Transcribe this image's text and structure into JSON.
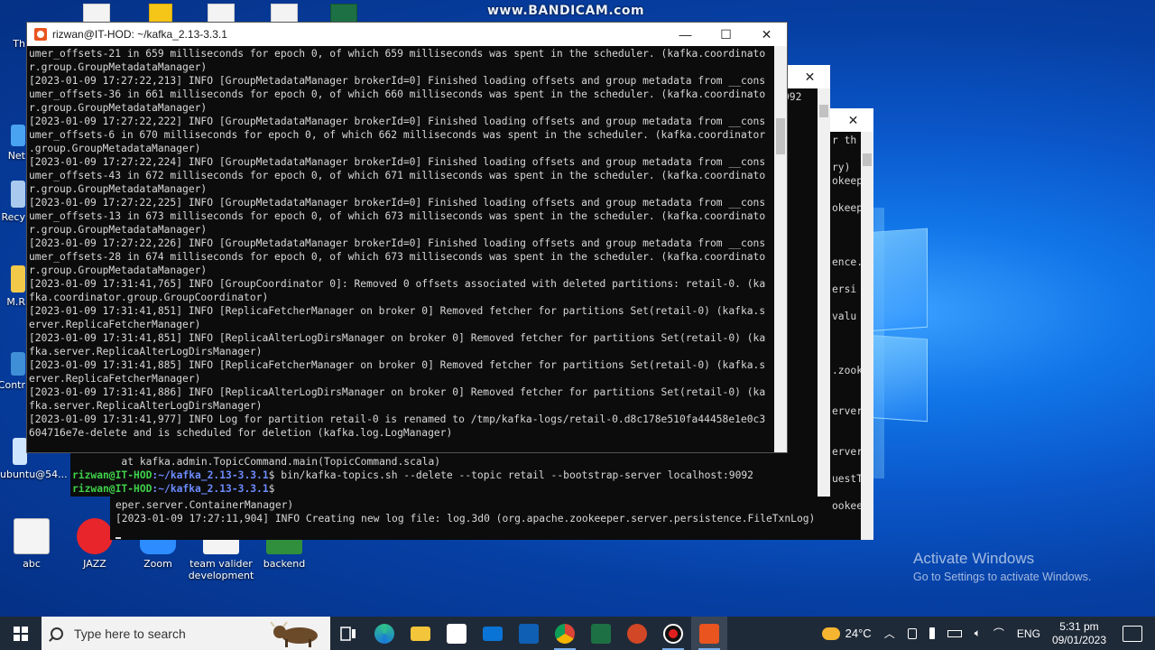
{
  "watermark": "www.BANDICAM.com",
  "desktop_icons": [
    {
      "id": "abc",
      "label": "abc"
    },
    {
      "id": "jazz",
      "label": "JAZZ"
    },
    {
      "id": "zoom",
      "label": "Zoom"
    },
    {
      "id": "team",
      "label": "team valider development"
    },
    {
      "id": "backend",
      "label": "backend"
    }
  ],
  "desktop_partial_labels": [
    "Th",
    "Net",
    "Recy",
    "M.R",
    "Contr",
    "ubuntu@54..."
  ],
  "main_window": {
    "title": "rizwan@IT-HOD: ~/kafka_2.13-3.3.1",
    "minimize": "—",
    "maximize": "☐",
    "close": "✕",
    "lines": [
      "umer_offsets-21 in 659 milliseconds for epoch 0, of which 659 milliseconds was spent in the scheduler. (kafka.coordinato",
      "r.group.GroupMetadataManager)",
      "[2023-01-09 17:27:22,213] INFO [GroupMetadataManager brokerId=0] Finished loading offsets and group metadata from __cons",
      "umer_offsets-36 in 661 milliseconds for epoch 0, of which 660 milliseconds was spent in the scheduler. (kafka.coordinato",
      "r.group.GroupMetadataManager)",
      "[2023-01-09 17:27:22,222] INFO [GroupMetadataManager brokerId=0] Finished loading offsets and group metadata from __cons",
      "umer_offsets-6 in 670 milliseconds for epoch 0, of which 662 milliseconds was spent in the scheduler. (kafka.coordinator",
      ".group.GroupMetadataManager)",
      "[2023-01-09 17:27:22,224] INFO [GroupMetadataManager brokerId=0] Finished loading offsets and group metadata from __cons",
      "umer_offsets-43 in 672 milliseconds for epoch 0, of which 671 milliseconds was spent in the scheduler. (kafka.coordinato",
      "r.group.GroupMetadataManager)",
      "[2023-01-09 17:27:22,225] INFO [GroupMetadataManager brokerId=0] Finished loading offsets and group metadata from __cons",
      "umer_offsets-13 in 673 milliseconds for epoch 0, of which 673 milliseconds was spent in the scheduler. (kafka.coordinato",
      "r.group.GroupMetadataManager)",
      "[2023-01-09 17:27:22,226] INFO [GroupMetadataManager brokerId=0] Finished loading offsets and group metadata from __cons",
      "umer_offsets-28 in 674 milliseconds for epoch 0, of which 673 milliseconds was spent in the scheduler. (kafka.coordinato",
      "r.group.GroupMetadataManager)",
      "[2023-01-09 17:31:41,765] INFO [GroupCoordinator 0]: Removed 0 offsets associated with deleted partitions: retail-0. (ka",
      "fka.coordinator.group.GroupCoordinator)",
      "[2023-01-09 17:31:41,851] INFO [ReplicaFetcherManager on broker 0] Removed fetcher for partitions Set(retail-0) (kafka.s",
      "erver.ReplicaFetcherManager)",
      "[2023-01-09 17:31:41,851] INFO [ReplicaAlterLogDirsManager on broker 0] Removed fetcher for partitions Set(retail-0) (ka",
      "fka.server.ReplicaAlterLogDirsManager)",
      "[2023-01-09 17:31:41,885] INFO [ReplicaFetcherManager on broker 0] Removed fetcher for partitions Set(retail-0) (kafka.s",
      "erver.ReplicaFetcherManager)",
      "[2023-01-09 17:31:41,886] INFO [ReplicaAlterLogDirsManager on broker 0] Removed fetcher for partitions Set(retail-0) (ka",
      "fka.server.ReplicaAlterLogDirsManager)",
      "[2023-01-09 17:31:41,977] INFO Log for partition retail-0 is renamed to /tmp/kafka-logs/retail-0.d8c178e510fa44458e1e0c3",
      "604716e7e-delete and is scheduled for deletion (kafka.log.LogManager)"
    ]
  },
  "middle_window": {
    "trace_line": "at kafka.admin.TopicCommand.main(TopicCommand.scala)",
    "prompt_user": "rizwan@IT-HOD",
    "prompt_path": ":~/kafka_2.13-3.3.1",
    "prompt_symbol": "$",
    "command": "bin/kafka-topics.sh --delete --topic retail --bootstrap-server localhost:9092",
    "prompt2_symbol": "$",
    "right_fragments": [
      "092",
      "",
      "",
      "",
      "",
      "",
      "",
      "",
      "",
      "",
      "",
      "",
      "",
      "",
      "",
      "",
      "",
      ""
    ]
  },
  "back_window": {
    "close": "✕",
    "right_fragments": [
      "r th",
      "",
      "ry)",
      "okeep",
      "",
      "okeep",
      "",
      "",
      "",
      "ence.",
      "",
      "ersi",
      "",
      "valu",
      "",
      "",
      "",
      ".zook",
      "",
      "",
      "erver",
      "",
      "",
      "erver.",
      "",
      "uestT",
      "",
      "ookeep"
    ],
    "bottom_lines": [
      "eper.server.ContainerManager)",
      "[2023-01-09 17:27:11,904] INFO Creating new log file: log.3d0 (org.apache.zookeeper.server.persistence.FileTxnLog)"
    ]
  },
  "activate": {
    "title": "Activate Windows",
    "subtitle": "Go to Settings to activate Windows."
  },
  "taskbar": {
    "search_placeholder": "Type here to search",
    "apps": [
      "task-view",
      "edge",
      "file-explorer",
      "store",
      "mail",
      "outlook",
      "chrome",
      "excel",
      "powerpoint",
      "bandicam",
      "ubuntu"
    ],
    "weather_temp": "24°C",
    "language": "ENG",
    "time": "5:31 pm",
    "date": "09/01/2023"
  },
  "colors": {
    "prompt_green": "#3fd14a",
    "prompt_blue": "#6c8bff",
    "terminal_bg": "#0c0c0c",
    "taskbar_bg": "#1f2a38"
  }
}
